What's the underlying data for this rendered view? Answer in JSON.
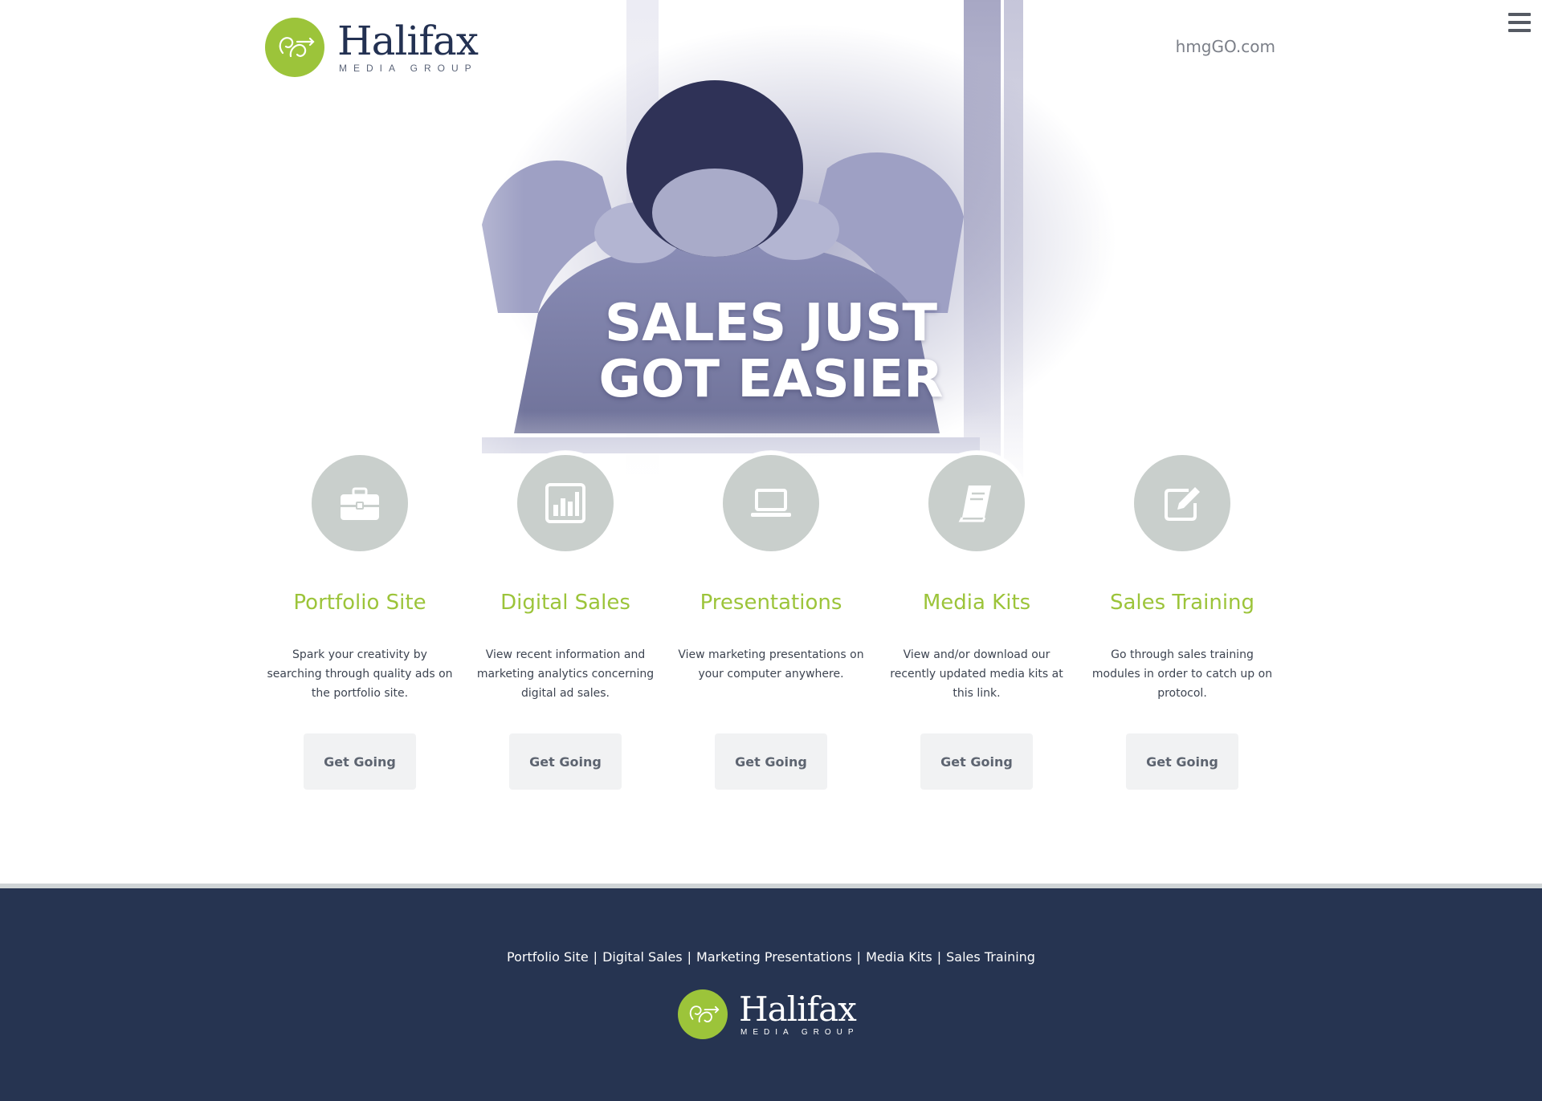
{
  "header": {
    "logo_word": "Halifax",
    "logo_sub": "MEDIA GROUP",
    "site_link": "hmgGO.com",
    "menu_icon": "hamburger-menu-icon"
  },
  "hero": {
    "title_line1": "SALES JUST",
    "title_line2": "GOT EASIER"
  },
  "features": [
    {
      "icon": "briefcase-icon",
      "title": "Portfolio Site",
      "description": "Spark your creativity by searching through quality ads on the portfolio site.",
      "cta": "Get Going"
    },
    {
      "icon": "bar-chart-icon",
      "title": "Digital Sales",
      "description": "View recent information and marketing analytics concerning digital ad sales.",
      "cta": "Get Going"
    },
    {
      "icon": "laptop-icon",
      "title": "Presentations",
      "description": "View marketing presentations on your computer anywhere.",
      "cta": "Get Going"
    },
    {
      "icon": "book-icon",
      "title": "Media Kits",
      "description": "View and/or download our recently updated media kits at this link.",
      "cta": "Get Going"
    },
    {
      "icon": "edit-icon",
      "title": "Sales Training",
      "description": "Go through sales training modules in order to catch up on protocol.",
      "cta": "Get Going"
    }
  ],
  "footer": {
    "links": [
      "Portfolio Site",
      "Digital Sales",
      "Marketing Presentations",
      "Media Kits",
      "Sales Training"
    ],
    "separator": "|",
    "logo_word": "Halifax",
    "logo_sub": "MEDIA GROUP"
  },
  "colors": {
    "accent_green": "#9cc43a",
    "navy": "#263451",
    "icon_circle": "#c9cfcc",
    "button_bg": "#f1f2f3"
  }
}
